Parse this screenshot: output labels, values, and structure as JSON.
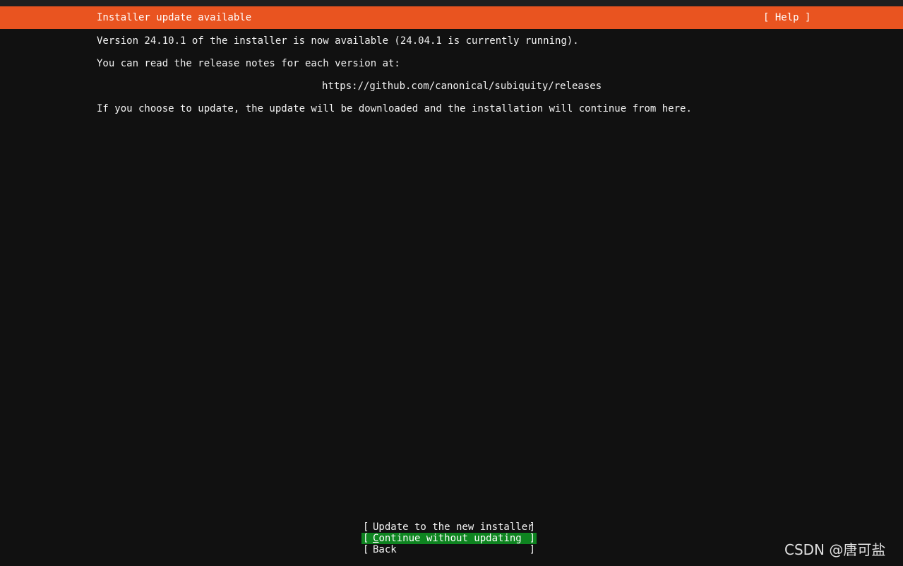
{
  "header": {
    "title": "Installer update available",
    "help_label": "[ Help ]"
  },
  "content": {
    "line1": "Version 24.10.1 of the installer is now available (24.04.1 is currently running).",
    "line2": "You can read the release notes for each version at:",
    "url": "https://github.com/canonical/subiquity/releases",
    "line3": "If you choose to update, the update will be downloaded and the installation will continue from here."
  },
  "buttons": {
    "update": "Update to the new installer",
    "continue_first": "C",
    "continue_rest": "ontinue without updating",
    "back": "Back",
    "left_bracket": "[",
    "right_bracket": "]"
  },
  "watermark": "CSDN @唐可盐",
  "colors": {
    "header_bg": "#e95420",
    "selected_bg": "#0e8420",
    "background": "#111111"
  }
}
